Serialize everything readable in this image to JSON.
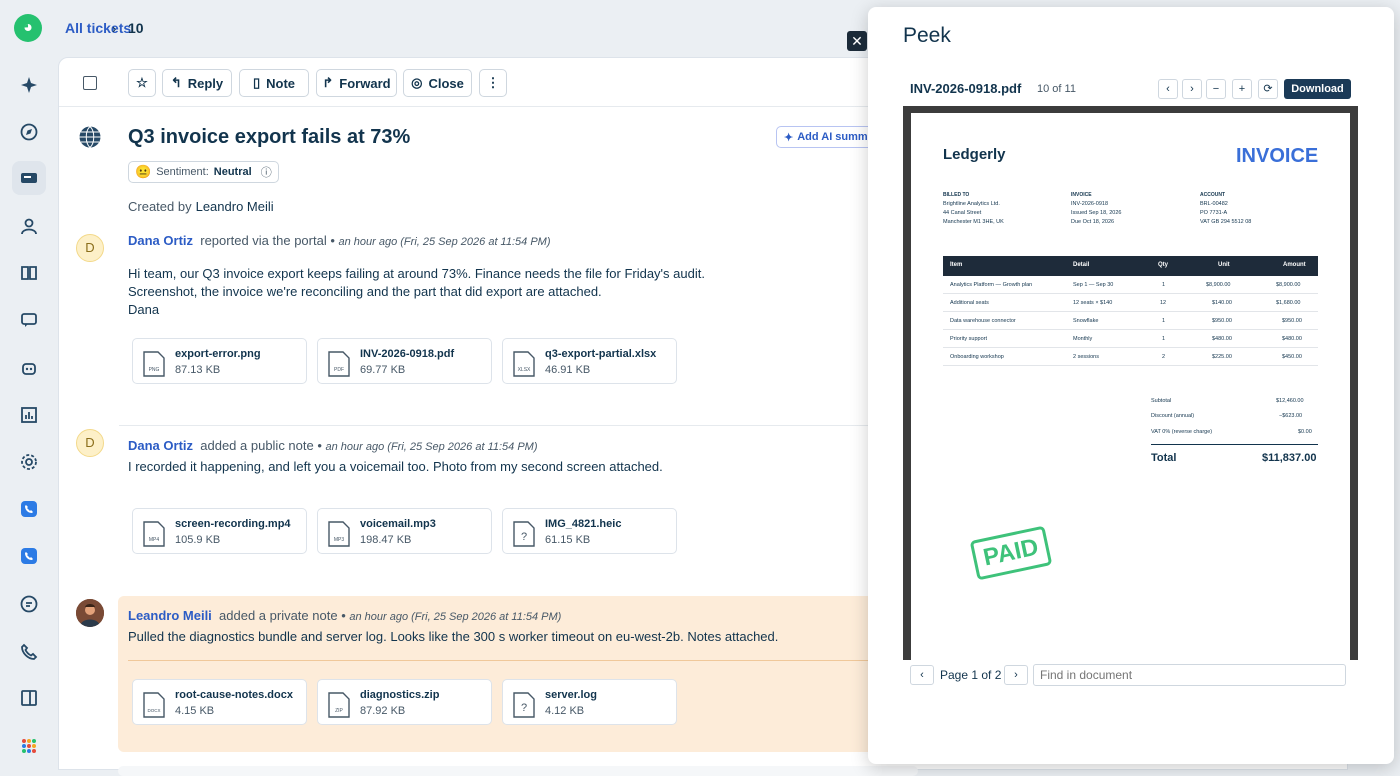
{
  "breadcrumb": {
    "root": "All tickets",
    "current": "10"
  },
  "toolbar": {
    "reply": "Reply",
    "note": "Note",
    "forward": "Forward",
    "close": "Close"
  },
  "ticket": {
    "title": "Q3 invoice export fails at 73%",
    "ai_button": "Add AI summary",
    "sentiment_label": "Sentiment:",
    "sentiment_value": "Neutral",
    "created_by_label": "Created by",
    "created_by": "Leandro Meili"
  },
  "messages": [
    {
      "avatar": "D",
      "author": "Dana Ortiz",
      "action": "reported via the portal",
      "time": "an hour ago (Fri, 25 Sep 2026 at 11:54 PM)",
      "body_lines": [
        "Hi team, our Q3 invoice export keeps failing at around 73%. Finance needs the file for Friday's audit.",
        "Screenshot, the invoice we're reconciling and the part that did export are attached.",
        "Dana"
      ],
      "attachments": [
        {
          "name": "export-error.png",
          "size": "87.13 KB",
          "ext": "PNG"
        },
        {
          "name": "INV-2026-0918.pdf",
          "size": "69.77 KB",
          "ext": "PDF"
        },
        {
          "name": "q3-export-partial.xlsx",
          "size": "46.91 KB",
          "ext": "XLSX"
        }
      ]
    },
    {
      "avatar": "D",
      "author": "Dana Ortiz",
      "action": "added a public note",
      "time": "an hour ago (Fri, 25 Sep 2026 at 11:54 PM)",
      "body_lines": [
        "I recorded it happening, and left you a voicemail too. Photo from my second screen attached."
      ],
      "attachments": [
        {
          "name": "screen-recording.mp4",
          "size": "105.9 KB",
          "ext": "MP4"
        },
        {
          "name": "voicemail.mp3",
          "size": "198.47 KB",
          "ext": "MP3"
        },
        {
          "name": "IMG_4821.heic",
          "size": "61.15 KB",
          "ext": "?"
        }
      ]
    },
    {
      "avatar": "",
      "author": "Leandro Meili",
      "action": "added a private note",
      "time": "an hour ago (Fri, 25 Sep 2026 at 11:54 PM)",
      "body_lines": [
        "Pulled the diagnostics bundle and server log. Looks like the 300 s worker timeout on eu-west-2b. Notes attached."
      ],
      "attachments": [
        {
          "name": "root-cause-notes.docx",
          "size": "4.15 KB",
          "ext": "DOCX"
        },
        {
          "name": "diagnostics.zip",
          "size": "87.92 KB",
          "ext": "ZIP"
        },
        {
          "name": "server.log",
          "size": "4.12 KB",
          "ext": "?"
        }
      ]
    }
  ],
  "peek": {
    "title": "Peek",
    "doc_name": "INV-2026-0918.pdf",
    "doc_count": "10 of 11",
    "download": "Download",
    "pager": "Page 1 of 2",
    "find_placeholder": "Find in document"
  },
  "invoice": {
    "brand": "Ledgerly",
    "heading": "INVOICE",
    "billed_to_label": "BILLED TO",
    "billed_to": [
      "Brightline Analytics Ltd.",
      "44 Canal Street",
      "Manchester M1 3HE, UK"
    ],
    "invoice_label": "INVOICE",
    "invoice_info": [
      "INV-2026-0918",
      "Issued Sep 18, 2026",
      "Due Oct 18, 2026"
    ],
    "account_label": "ACCOUNT",
    "account_info": [
      "BRL-00482",
      "PO 7731-A",
      "VAT GB 294 5512 08"
    ],
    "columns": [
      "Item",
      "Detail",
      "Qty",
      "Unit",
      "Amount"
    ],
    "rows": [
      [
        "Analytics Platform — Growth plan",
        "Sep 1 — Sep 30",
        "1",
        "$8,900.00",
        "$8,900.00"
      ],
      [
        "Additional seats",
        "12 seats × $140",
        "12",
        "$140.00",
        "$1,680.00"
      ],
      [
        "Data warehouse connector",
        "Snowflake",
        "1",
        "$950.00",
        "$950.00"
      ],
      [
        "Priority support",
        "Monthly",
        "1",
        "$480.00",
        "$480.00"
      ],
      [
        "Onboarding workshop",
        "2 sessions",
        "2",
        "$225.00",
        "$450.00"
      ]
    ],
    "subtotal_label": "Subtotal",
    "subtotal": "$12,460.00",
    "discount_label": "Discount (annual)",
    "discount": "−$623.00",
    "vat_label": "VAT 0% (reverse charge)",
    "vat": "$0.00",
    "total_label": "Total",
    "total": "$11,837.00",
    "stamp": "PAID"
  }
}
